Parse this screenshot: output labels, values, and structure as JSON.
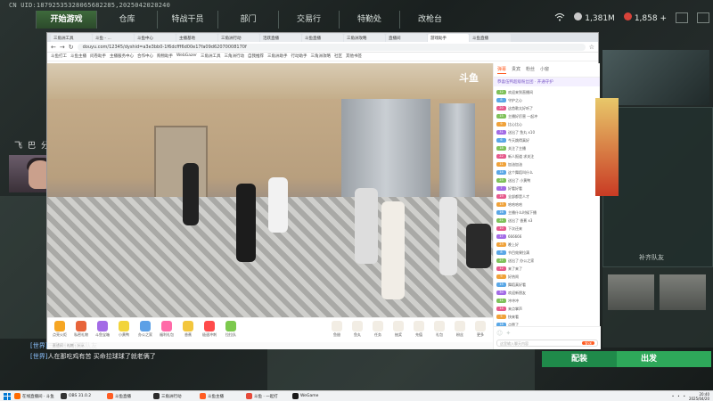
{
  "game": {
    "uid_text": "CN UID:18792535328065682285,2025042020240",
    "nav": [
      "开始游戏",
      "仓库",
      "特战干员",
      "部门",
      "交易行",
      "特勤处",
      "改枪台"
    ],
    "nav_active": 0,
    "currency_a": "1,381M",
    "currency_b": "1,858",
    "currency_b_plus": "+"
  },
  "streamer": {
    "name_chars": [
      "飞",
      "巴",
      "分",
      "前"
    ]
  },
  "browser": {
    "tabs": [
      "三角洲工具",
      "斗鱼 - ...",
      "斗鱼中心",
      "主播基地",
      "三角洲行动",
      "活跃直播",
      "斗鱼直播",
      "三角洲攻略",
      "直播间",
      "游戏助手",
      "斗鱼直播"
    ],
    "active_tab": 9,
    "url": "douyu.com/12345/dyshid=a3e3bb0-1f6dcfff6d00e17fa09d62070008170f",
    "bookmarks": [
      "斗鱼打工",
      "斗鱼主播",
      "问卷助手",
      "主播服务中心",
      "合作中心",
      "购物助手",
      "WebGazer",
      "三角洲工具",
      "三角洲行动",
      "自我推荐",
      "三角洲助手",
      "行动助手",
      "三角洲攻略",
      "社区",
      "其他书签"
    ]
  },
  "video": {
    "logo": "斗鱼"
  },
  "controls": {
    "gifts": [
      {
        "label": "点亮火炬",
        "color": "#f6a623"
      },
      {
        "label": "私密礼物",
        "color": "#e7643a"
      },
      {
        "label": "斗鱼宝箱",
        "color": "#a36be6"
      },
      {
        "label": "小黄鸭",
        "color": "#f2d43a"
      },
      {
        "label": "办公之家",
        "color": "#5ca0e6"
      },
      {
        "label": "福利礼包",
        "color": "#ff6aa8"
      },
      {
        "label": "香蕉",
        "color": "#f3c63d"
      },
      {
        "label": "极速冲刺",
        "color": "#ff4b4b"
      },
      {
        "label": "拉拉队",
        "color": "#7cc94d"
      }
    ],
    "right_items": [
      "鱼翅",
      "鱼丸",
      "任务",
      "抽奖",
      "充值",
      "礼包",
      "粉丝",
      "更多"
    ],
    "info_text": "直播间 · 礼物 · 分享"
  },
  "chat": {
    "tabs": [
      "弹幕",
      "贵宾",
      "粉丝",
      "小窗"
    ],
    "active_tab": 0,
    "banner": "恭喜伍鸭超级粉丝团 · 开通守护",
    "messages": [
      {
        "level": "12",
        "color": "#7fc15a",
        "text": "欢迎来到直播间"
      },
      {
        "level": "8",
        "color": "#5aa7e6",
        "text": "守护之心"
      },
      {
        "level": "20",
        "color": "#e65a8c",
        "text": "这首歌太好听了"
      },
      {
        "level": "15",
        "color": "#7fc15a",
        "text": "主播好厉害 一起冲"
      },
      {
        "level": "9",
        "color": "#f0a23a",
        "text": "比心比心"
      },
      {
        "level": "31",
        "color": "#a36be6",
        "text": "送出了 鱼丸 x10"
      },
      {
        "level": "6",
        "color": "#5aa7e6",
        "text": "今天跳得真好"
      },
      {
        "level": "18",
        "color": "#7fc15a",
        "text": "关注了主播"
      },
      {
        "level": "22",
        "color": "#e65a8c",
        "text": "新人报道 求关注"
      },
      {
        "level": "11",
        "color": "#f0a23a",
        "text": "加油加油"
      },
      {
        "level": "14",
        "color": "#5aa7e6",
        "text": "这个舞蹈叫什么"
      },
      {
        "level": "25",
        "color": "#7fc15a",
        "text": "送出了 小黄鸭"
      },
      {
        "level": "7",
        "color": "#a36be6",
        "text": "好看好看"
      },
      {
        "level": "19",
        "color": "#e65a8c",
        "text": "全部都是人才"
      },
      {
        "level": "13",
        "color": "#f0a23a",
        "text": "哈哈哈哈"
      },
      {
        "level": "16",
        "color": "#5aa7e6",
        "text": "主播什么时候下播"
      },
      {
        "level": "21",
        "color": "#7fc15a",
        "text": "送出了 香蕉 x3"
      },
      {
        "level": "10",
        "color": "#e65a8c",
        "text": "下次还来"
      },
      {
        "level": "17",
        "color": "#a36be6",
        "text": "666666"
      },
      {
        "level": "23",
        "color": "#f0a23a",
        "text": "晚上好"
      },
      {
        "level": "8",
        "color": "#5aa7e6",
        "text": "节目效果拉满"
      },
      {
        "level": "27",
        "color": "#7fc15a",
        "text": "送出了 办公之家"
      },
      {
        "level": "12",
        "color": "#e65a8c",
        "text": "来了来了"
      },
      {
        "level": "9",
        "color": "#f0a23a",
        "text": "好热闹"
      },
      {
        "level": "15",
        "color": "#5aa7e6",
        "text": "舞蹈真好看"
      },
      {
        "level": "30",
        "color": "#a36be6",
        "text": "欢迎新朋友"
      },
      {
        "level": "11",
        "color": "#7fc15a",
        "text": "冲冲冲"
      },
      {
        "level": "14",
        "color": "#e65a8c",
        "text": "来点掌声"
      },
      {
        "level": "5",
        "color": "#f0a23a",
        "text": "快来看"
      },
      {
        "level": "18",
        "color": "#5aa7e6",
        "text": "点赞了"
      }
    ],
    "input_placeholder": "这里输入聊天内容",
    "send_label": "发送"
  },
  "right_panel": {
    "label": "补齐队友"
  },
  "buttons": {
    "match": "配装",
    "deploy": "出发"
  },
  "world_chat": [
    {
      "tag": "[世界]",
      "text": "三角洲 · 招募队友"
    },
    {
      "tag": "[世界]",
      "text": "人在那吃鸡有苦 买命拉球球了就老俩了"
    }
  ],
  "taskbar": {
    "items": [
      {
        "label": "在线直播间 · 斗鱼",
        "color": "#ff6a00"
      },
      {
        "label": "OBS 31.0.2",
        "color": "#333"
      },
      {
        "label": "斗鱼直播",
        "color": "#ff5d23"
      },
      {
        "label": "三角洲行动",
        "color": "#2b2b2b"
      },
      {
        "label": "斗鱼主播",
        "color": "#ff5d23"
      },
      {
        "label": "斗鱼 · 一起打",
        "color": "#e64a3a"
      },
      {
        "label": "WeGame",
        "color": "#1a1a1a"
      }
    ],
    "time": "20:40",
    "date": "2025/04/20"
  }
}
